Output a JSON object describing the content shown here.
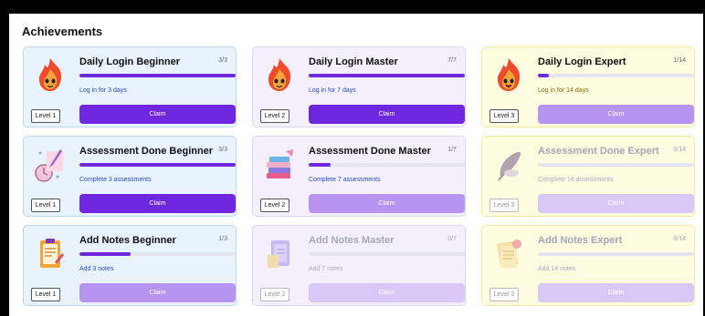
{
  "title": "Achievements",
  "cards": [
    {
      "title": "Daily Login Beginner",
      "count": "3/3",
      "desc": "Log in for 3 days",
      "level": "Level 1",
      "claim": "Claim",
      "progress": 1.0
    },
    {
      "title": "Daily Login Master",
      "count": "7/7",
      "desc": "Log in for 7 days",
      "level": "Level 2",
      "claim": "Claim",
      "progress": 1.0
    },
    {
      "title": "Daily Login Expert",
      "count": "1/14",
      "desc": "Log in for 14 days",
      "level": "Level 3",
      "claim": "Claim",
      "progress": 0.07
    },
    {
      "title": "Assessment Done Beginner",
      "count": "3/3",
      "desc": "Complete 3 assessments",
      "level": "Level 1",
      "claim": "Claim",
      "progress": 1.0
    },
    {
      "title": "Assessment Done Master",
      "count": "1/7",
      "desc": "Complete 7 assessments",
      "level": "Level 2",
      "claim": "Claim",
      "progress": 0.14
    },
    {
      "title": "Assessment Done Expert",
      "count": "0/14",
      "desc": "Complete 14 assessments",
      "level": "Level 3",
      "claim": "Claim",
      "progress": 0
    },
    {
      "title": "Add Notes Beginner",
      "count": "1/3",
      "desc": "Add 3 notes",
      "level": "Level 1",
      "claim": "Claim",
      "progress": 0.33
    },
    {
      "title": "Add Notes Master",
      "count": "0/7",
      "desc": "Add 7 notes",
      "level": "Level 2",
      "claim": "Claim",
      "progress": 0
    },
    {
      "title": "Add Notes Expert",
      "count": "0/14",
      "desc": "Add 14 notes",
      "level": "Level 3",
      "claim": "Claim",
      "progress": 0
    }
  ],
  "colors": {
    "accent": "#6e26df",
    "blue_card": "#e9f3fd",
    "purple_card": "#f3f0fc",
    "yellow_card": "#fdfbe0"
  },
  "icons": [
    "flame-mascot-icon",
    "flame-mascot-icon",
    "flame-mascot-icon",
    "clipboard-pen-icon",
    "books-icon",
    "quill-icon",
    "notepad-icon",
    "notebook-icon",
    "notes-icon"
  ]
}
